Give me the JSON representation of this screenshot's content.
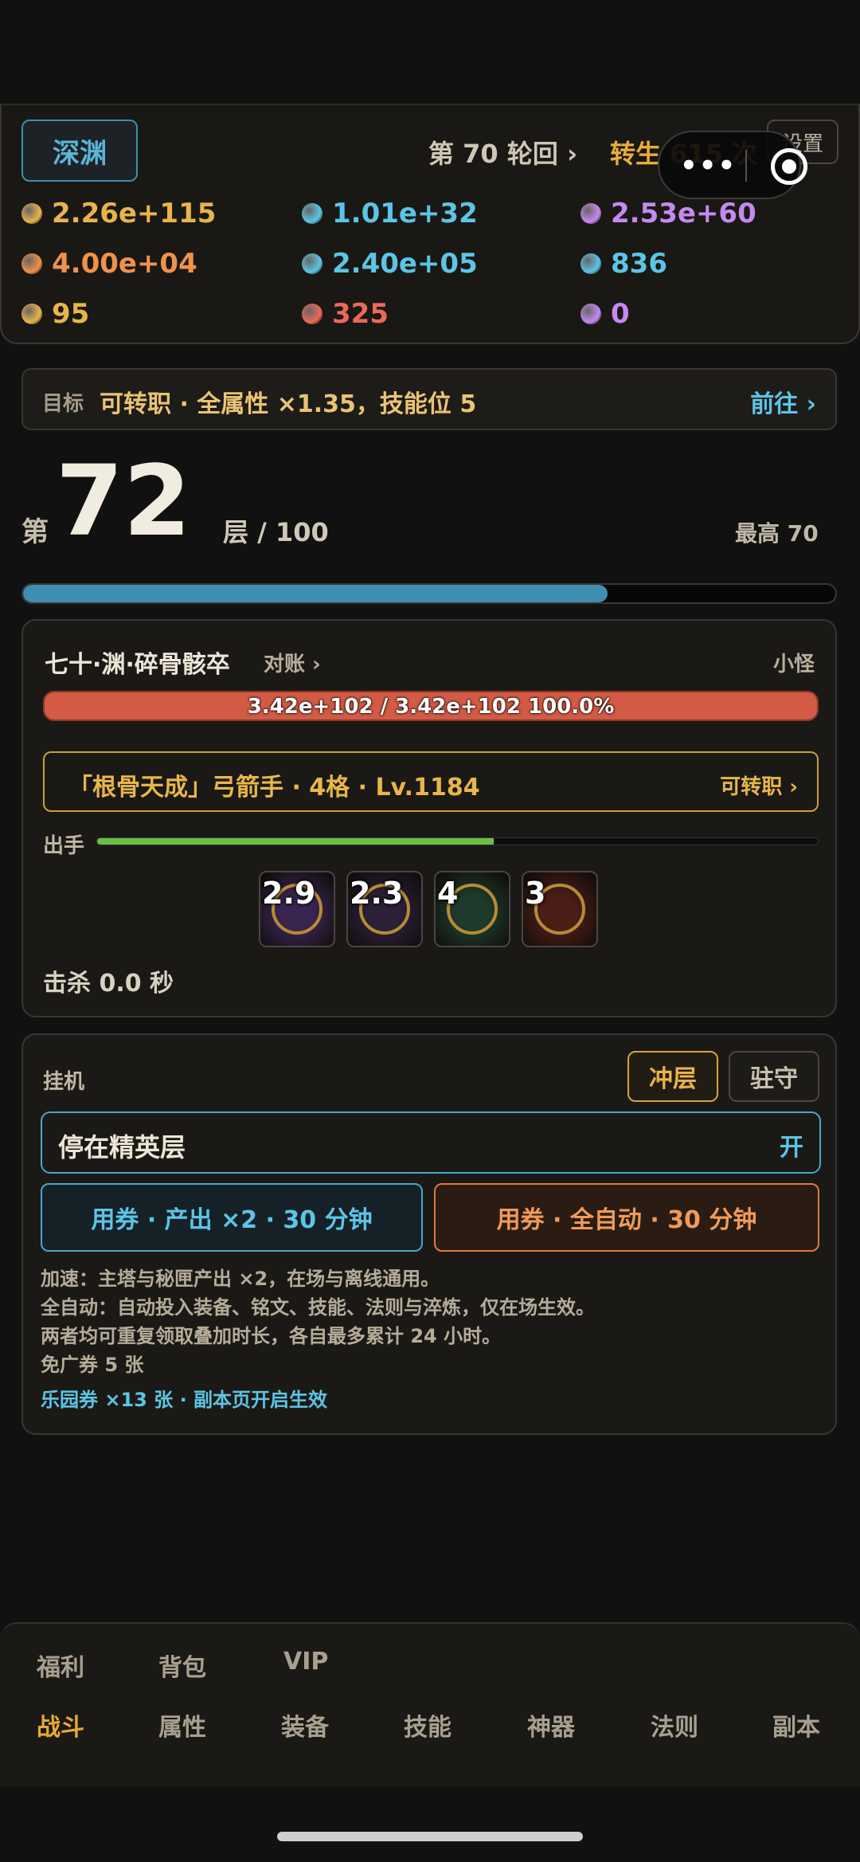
{
  "header": {
    "realm_label": "深渊",
    "round_text": "第 70 轮回 ›",
    "rebirth_text": "转生 615 次",
    "settings_label": "设置"
  },
  "resources": [
    {
      "value": "2.26e+115",
      "color": "#e9b44a",
      "icon": "gold-coin-icon"
    },
    {
      "value": "1.01e+32",
      "color": "#5cc5e6",
      "icon": "blue-gem-icon"
    },
    {
      "value": "2.53e+60",
      "color": "#c58af0",
      "icon": "purple-orb-icon"
    },
    {
      "value": "4.00e+04",
      "color": "#f0924a",
      "icon": "orange-pumpkin-icon"
    },
    {
      "value": "2.40e+05",
      "color": "#5cc5e6",
      "icon": "bottle-icon"
    },
    {
      "value": "836",
      "color": "#5cc5e6",
      "icon": "red-shell-icon"
    },
    {
      "value": "95",
      "color": "#e9b44a",
      "icon": "ticket-icon"
    },
    {
      "value": "325",
      "color": "#ea6a5a",
      "icon": "red-crystal-icon"
    },
    {
      "value": "0",
      "color": "#c58af0",
      "icon": "violet-orb-icon"
    }
  ],
  "goal": {
    "label": "目标",
    "text": "可转职 · 全属性 ×1.35，技能位 5",
    "go_label": "前往 ›"
  },
  "floor": {
    "prefix": "第",
    "current": "72",
    "suffix": "层 / 100",
    "max_text": "最高 70",
    "progress": 0.72
  },
  "battle": {
    "enemy_name": "七十·渊·碎骨骸卒",
    "enemy_link": "对账 ›",
    "enemy_type": "小怪",
    "hp_text": "3.42e+102 / 3.42e+102   100.0%",
    "hp_fraction": 1.0,
    "hero_text": "「根骨天成」弓箭手 · 4格 · Lv.1184",
    "hero_job": "可转职 ›",
    "attack_label": "出手",
    "attack_progress": 0.55,
    "skills": [
      {
        "cooldown": "2.9",
        "icon": "purple-vortex-skill-icon",
        "bg": "#3a2550"
      },
      {
        "cooldown": "2.3",
        "icon": "dark-orb-skill-icon",
        "bg": "#2b2038"
      },
      {
        "cooldown": "4",
        "icon": "green-wind-skill-icon",
        "bg": "#1e3a2a"
      },
      {
        "cooldown": "3",
        "icon": "fire-slash-skill-icon",
        "bg": "#4a1e16"
      }
    ],
    "kill_text": "击杀 0.0 秒"
  },
  "idle": {
    "title": "挂机",
    "mode_rush": "冲层",
    "mode_stay": "驻守",
    "stop_elite_label": "停在精英层",
    "stop_elite_state": "开",
    "ticket_speed": "用券 · 产出 ×2 · 30 分钟",
    "ticket_auto": "用券 · 全自动 · 30 分钟",
    "info_lines": [
      "加速：主塔与秘匣产出 ×2，在场与离线通用。",
      "全自动：自动投入装备、铭文、技能、法则与淬炼，仅在场生效。",
      "两者均可重复领取叠加时长，各自最多累计 24 小时。",
      "免广券 5 张"
    ],
    "voucher_text": "乐园券 ×13 张 · 副本页开启生效"
  },
  "nav": {
    "row1": [
      "福利",
      "背包",
      "VIP"
    ],
    "row2": [
      "战斗",
      "属性",
      "装备",
      "技能",
      "神器",
      "法则",
      "副本"
    ],
    "active": "战斗"
  }
}
